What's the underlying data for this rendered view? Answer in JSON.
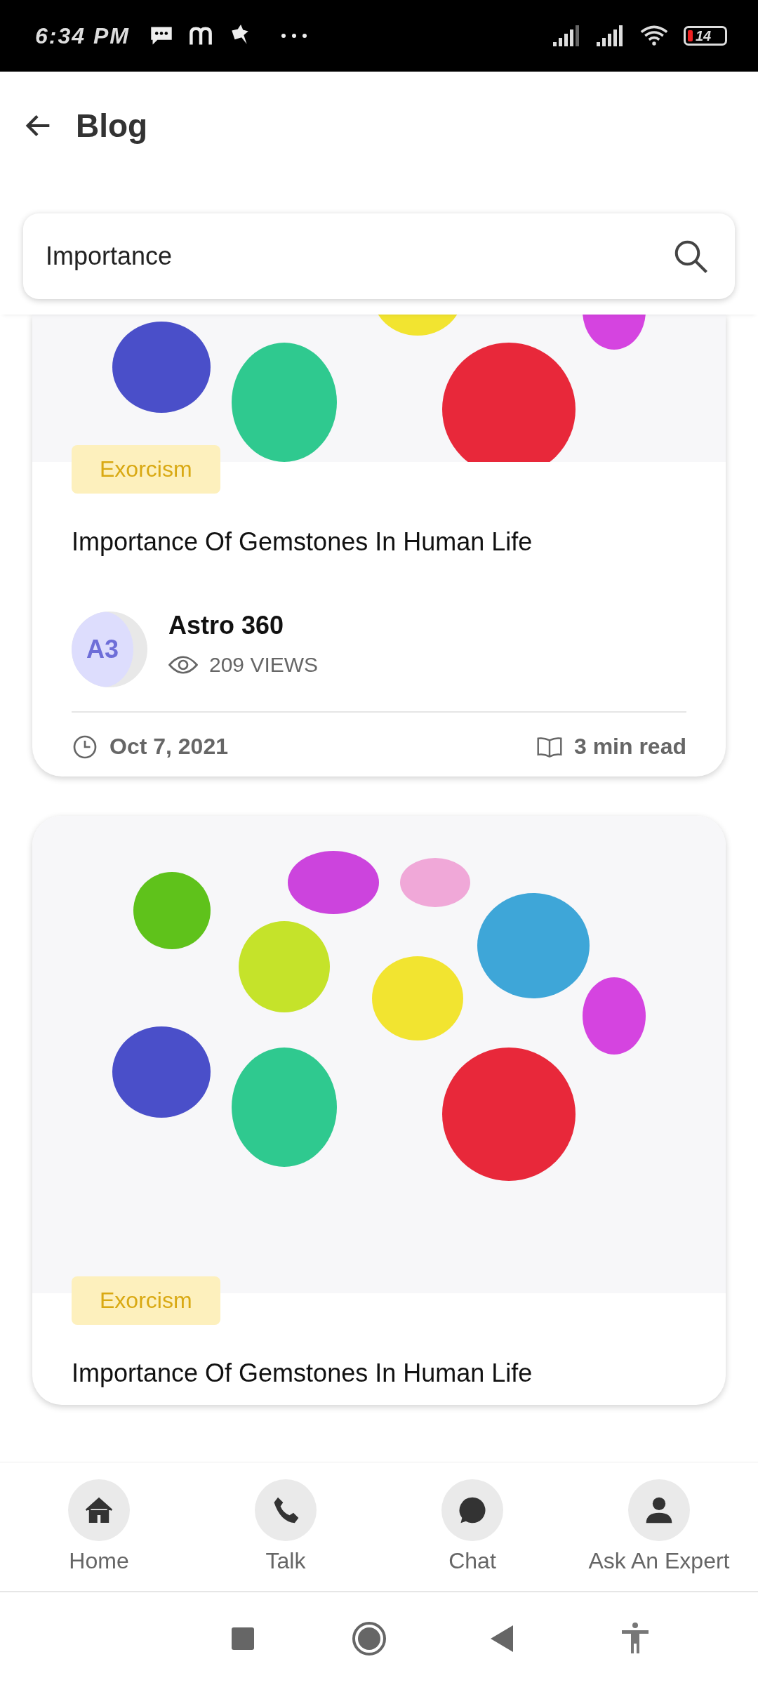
{
  "status_bar": {
    "time": "6:34 PM",
    "battery": "14"
  },
  "app_bar": {
    "title": "Blog"
  },
  "search": {
    "value": "Importance"
  },
  "posts": [
    {
      "tag": "Exorcism",
      "title": "Importance Of Gemstones In Human Life",
      "author": {
        "initials": "A3",
        "name": "Astro 360",
        "views": "209 VIEWS"
      },
      "date": "Oct 7, 2021",
      "read_time": "3 min read"
    },
    {
      "tag": "Exorcism",
      "title": "Importance Of Gemstones In Human Life"
    }
  ],
  "bottom_nav": [
    {
      "label": "Home"
    },
    {
      "label": "Talk"
    },
    {
      "label": "Chat"
    },
    {
      "label": "Ask An Expert"
    }
  ]
}
